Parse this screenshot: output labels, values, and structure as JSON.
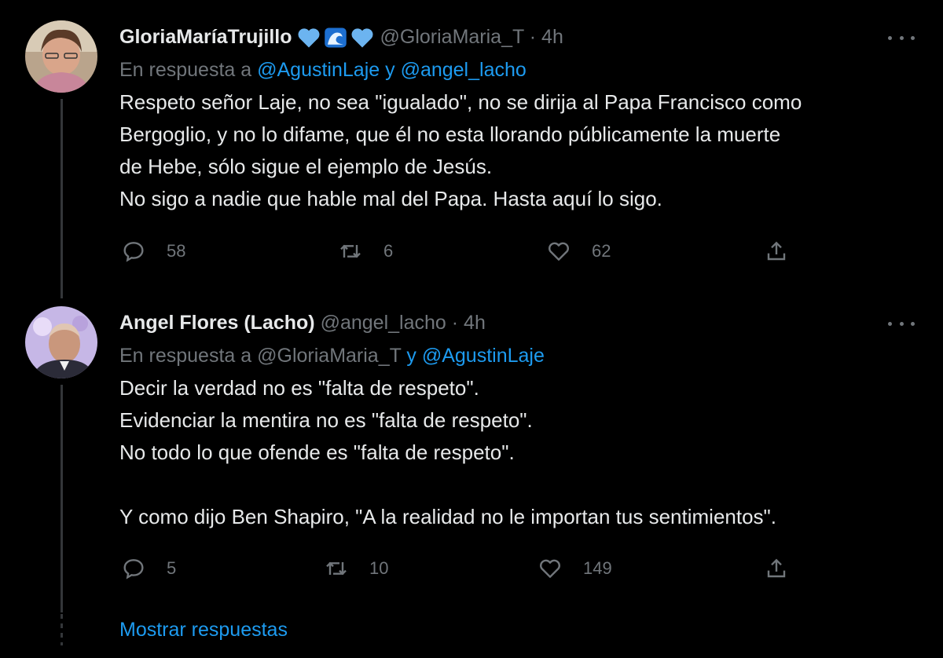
{
  "tweets": [
    {
      "name": "GloriaMaríaTrujillo",
      "badges": [
        "blue-heart-icon",
        "wave-icon",
        "blue-heart-icon"
      ],
      "handle": "@GloriaMaria_T",
      "time": "4h",
      "reply_prefix": "En respuesta a",
      "reply_mentions": [
        "@AgustinLaje",
        "@angel_lacho"
      ],
      "reply_joiner": "y",
      "body": "Respeto señor Laje, no sea \"igualado\", no se dirija al Papa Francisco como\nBergoglio, y no lo difame, que él no esta llorando públicamente la muerte\nde Hebe, sólo sigue el ejemplo de Jesús.\nNo sigo a nadie que hable mal del Papa.  Hasta aquí lo sigo.",
      "replies": "58",
      "retweets": "6",
      "likes": "62"
    },
    {
      "name": "Angel Flores (Lacho)",
      "handle": "@angel_lacho",
      "time": "4h",
      "reply_prefix": "En respuesta a",
      "reply_mentions": [
        "@GloriaMaria_T",
        "@AgustinLaje"
      ],
      "reply_joiner": "y",
      "body": "Decir la verdad no es \"falta de respeto\".\nEvidenciar la mentira no es \"falta de respeto\".\nNo todo lo que ofende es \"falta de respeto\".\n\nY como dijo Ben Shapiro, \"A la realidad no le importan tus sentimientos\".",
      "replies": "5",
      "retweets": "10",
      "likes": "149"
    }
  ],
  "separator": "·",
  "show_replies": "Mostrar respuestas",
  "colors": {
    "background": "#000000",
    "text": "#e7e9ea",
    "muted": "#71767b",
    "link": "#1d9bf0"
  }
}
